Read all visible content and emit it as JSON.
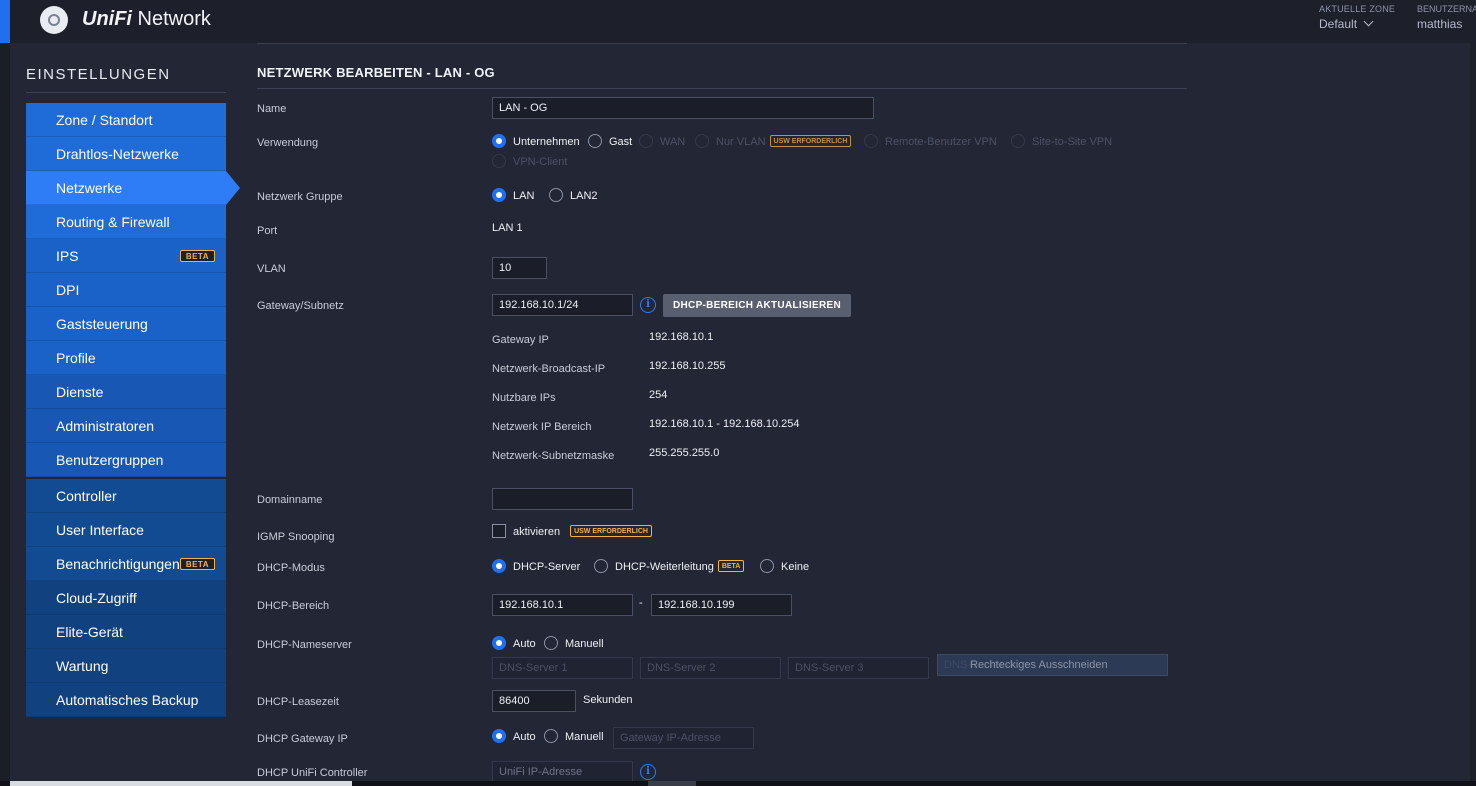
{
  "app": {
    "brand_prefix": "UniFi",
    "brand_suffix": " Network",
    "zone_label": "AKTUELLE ZONE",
    "zone_value": "Default",
    "user_label": "BENUTZERNAME",
    "user_value": "matthias"
  },
  "sidebar": {
    "title": "EINSTELLUNGEN",
    "group1": [
      {
        "label": "Zone / Standort"
      },
      {
        "label": "Drahtlos-Netzwerke"
      },
      {
        "label": "Netzwerke"
      },
      {
        "label": "Routing & Firewall"
      },
      {
        "label": "IPS",
        "badge": "BETA"
      },
      {
        "label": "DPI"
      },
      {
        "label": "Gaststeuerung"
      },
      {
        "label": "Profile"
      },
      {
        "label": "Dienste"
      },
      {
        "label": "Administratoren"
      },
      {
        "label": "Benutzergruppen"
      }
    ],
    "group2": [
      {
        "label": "Controller"
      },
      {
        "label": "User Interface"
      },
      {
        "label": "Benachrichtigungen",
        "badge": "BETA"
      },
      {
        "label": "Cloud-Zugriff"
      },
      {
        "label": "Elite-Gerät"
      },
      {
        "label": "Wartung"
      },
      {
        "label": "Automatisches Backup"
      }
    ],
    "active": "Netzwerke"
  },
  "form": {
    "title": "NETZWERK BEARBEITEN - LAN - OG",
    "name": {
      "label": "Name",
      "value": "LAN - OG"
    },
    "verwendung": {
      "label": "Verwendung",
      "options": [
        "Unternehmen",
        "Gast",
        "WAN",
        "Nur VLAN",
        "Remote-Benutzer VPN",
        "Site-to-Site VPN",
        "VPN-Client"
      ],
      "usw_badge": "USW ERFORDERLICH",
      "selected": "Unternehmen"
    },
    "gruppe": {
      "label": "Netzwerk Gruppe",
      "options": [
        "LAN",
        "LAN2"
      ],
      "selected": "LAN"
    },
    "port": {
      "label": "Port",
      "value": "LAN 1"
    },
    "vlan": {
      "label": "VLAN",
      "value": "10"
    },
    "gateway": {
      "label": "Gateway/Subnetz",
      "value": "192.168.10.1/24",
      "button": "DHCP-BEREICH AKTUALISIEREN",
      "info": "i"
    },
    "details": [
      {
        "label": "Gateway IP",
        "value": "192.168.10.1"
      },
      {
        "label": "Netzwerk-Broadcast-IP",
        "value": "192.168.10.255"
      },
      {
        "label": "Nutzbare IPs",
        "value": "254"
      },
      {
        "label": "Netzwerk IP Bereich",
        "value": "192.168.10.1 - 192.168.10.254"
      },
      {
        "label": "Netzwerk-Subnetzmaske",
        "value": "255.255.255.0"
      }
    ],
    "domain": {
      "label": "Domainname",
      "value": ""
    },
    "igmp": {
      "label": "IGMP Snooping",
      "checkbox_label": "aktivieren",
      "badge": "USW ERFORDERLICH"
    },
    "dhcp_mode": {
      "label": "DHCP-Modus",
      "options": [
        "DHCP-Server",
        "DHCP-Weiterleitung",
        "Keine"
      ],
      "badge": "BETA",
      "selected": "DHCP-Server"
    },
    "dhcp_range": {
      "label": "DHCP-Bereich",
      "start": "192.168.10.1",
      "sep": "-",
      "end": "192.168.10.199"
    },
    "nameserver": {
      "label": "DHCP-Nameserver",
      "options": [
        "Auto",
        "Manuell"
      ],
      "selected": "Auto",
      "placeholders": [
        "DNS-Server 1",
        "DNS-Server 2",
        "DNS-Server 3",
        "DNS-Server 4"
      ],
      "tooltip": "Rechteckiges Ausschneiden"
    },
    "lease": {
      "label": "DHCP-Leasezeit",
      "value": "86400",
      "unit": "Sekunden"
    },
    "gateway_ip": {
      "label": "DHCP Gateway IP",
      "options": [
        "Auto",
        "Manuell"
      ],
      "selected": "Auto",
      "placeholder": "Gateway IP-Adresse"
    },
    "controller": {
      "label": "DHCP UniFi Controller",
      "placeholder": "UniFi IP-Adresse",
      "info": "i"
    }
  },
  "colors": {
    "accent": "#1f6ff0",
    "badge": "#f2b340",
    "background": "#232634"
  }
}
